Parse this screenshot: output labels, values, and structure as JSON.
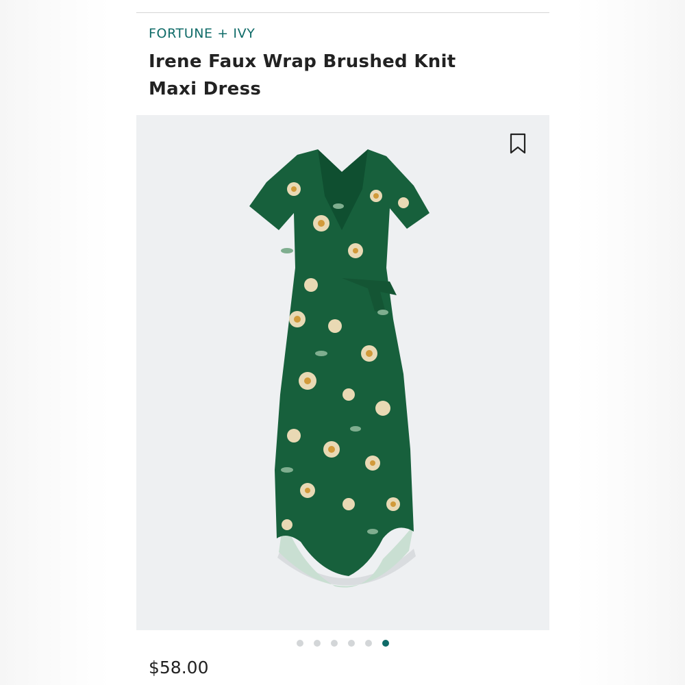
{
  "top_strip": {
    "text": ""
  },
  "product": {
    "brand": "FORTUNE + IVY",
    "title": "Irene Faux Wrap Brushed Knit Maxi Dress",
    "price": "$58.00"
  },
  "gallery": {
    "image_subject": "green floral faux wrap maxi dress",
    "total_images": 6,
    "active_index": 5
  },
  "icons": {
    "bookmark": "bookmark-icon"
  },
  "colors": {
    "accent": "#0f6b68",
    "image_background": "#eef0f2",
    "dress_green": "#17603c",
    "dot_inactive": "#d3d6d8"
  }
}
